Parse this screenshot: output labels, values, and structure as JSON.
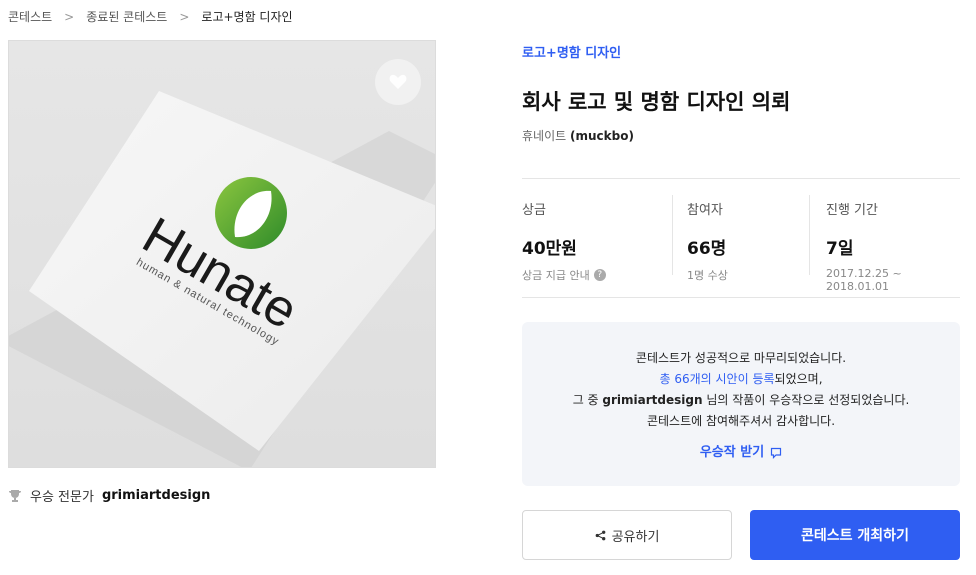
{
  "breadcrumb": {
    "items": [
      "콘테스트",
      "종료된 콘테스트",
      "로고+명함 디자인"
    ]
  },
  "artwork": {
    "brand_name": "Hunate",
    "brand_tagline": "human & natural technology",
    "logo_color": "#3fa02c"
  },
  "winner": {
    "prefix": "우승 전문가",
    "name": "grimiartdesign"
  },
  "contest": {
    "category": "로고+명함 디자인",
    "title": "회사 로고 및 명함 디자인 의뢰",
    "host_name": "휴네이트",
    "host_id": "(muckbo)"
  },
  "stats": {
    "prize": {
      "label": "상금",
      "value": "40만원",
      "sub": "상금 지급 안내"
    },
    "participants": {
      "label": "참여자",
      "value": "66명",
      "sub": "1명 수상"
    },
    "period": {
      "label": "진행 기간",
      "value": "7일",
      "sub": "2017.12.25 ~ 2018.01.01"
    }
  },
  "notice": {
    "line1": "콘테스트가 성공적으로 마무리되었습니다.",
    "line2_highlight": "총 66개의 시안이 등록",
    "line2_rest": "되었으며,",
    "line3_prefix": "그 중",
    "line3_name": "grimiartdesign",
    "line3_rest": "님의 작품이 우승작으로 선정되었습니다.",
    "line4": "콘테스트에 참여해주셔서 감사합니다.",
    "get_winner_label": "우승작 받기"
  },
  "actions": {
    "share_label": "공유하기",
    "host_label": "콘테스트 개최하기"
  },
  "colors": {
    "accent": "#2f5ef2",
    "logo_green": "#3fa02c"
  }
}
